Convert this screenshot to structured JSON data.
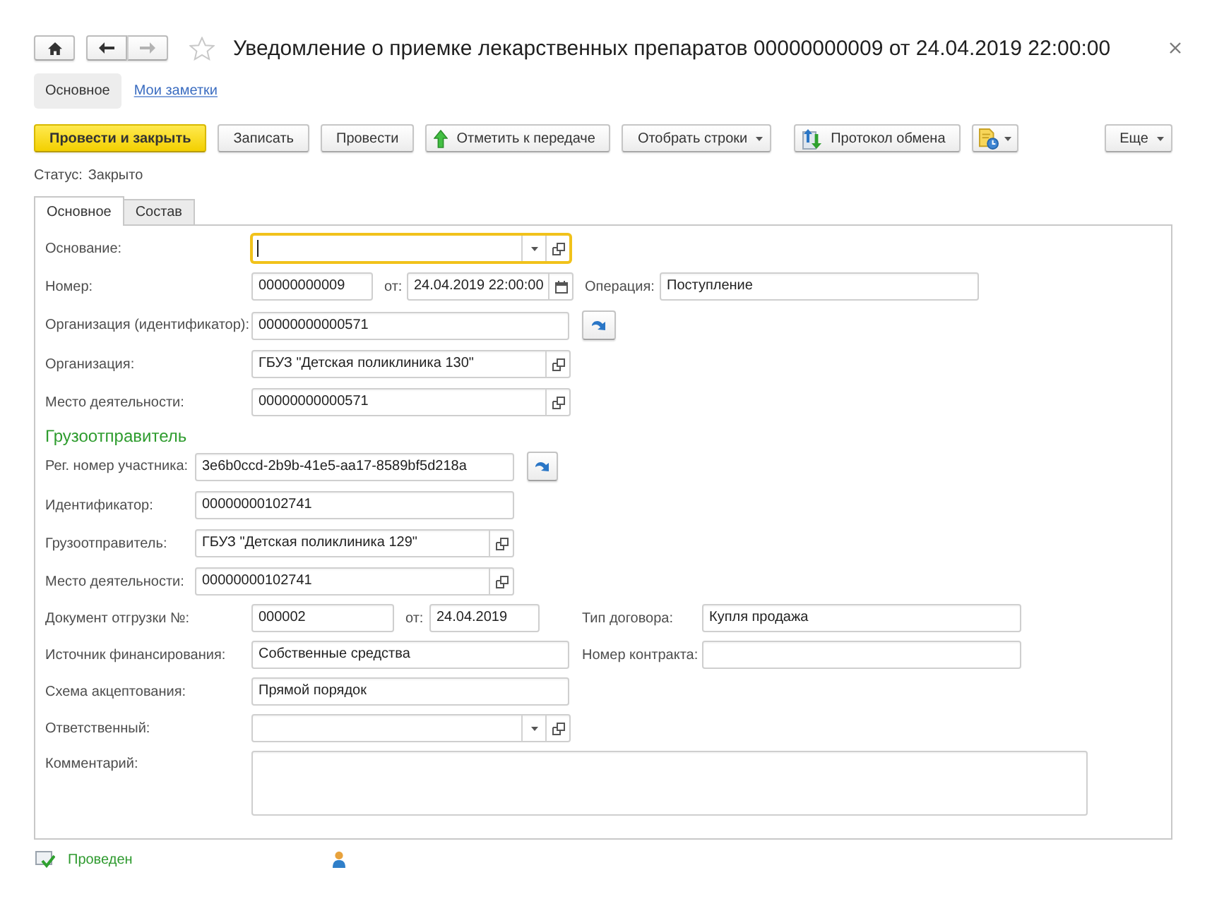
{
  "navigation": [
    {
      "kind": "home",
      "disabled": false
    },
    {
      "kind": "back",
      "disabled": false
    },
    {
      "kind": "forward",
      "disabled": true
    }
  ],
  "header": {
    "title": "Уведомление о приемке лекарственных препаратов 00000000009 от 24.04.2019 22:00:00",
    "starred": false
  },
  "sections": [
    {
      "label": "Основное",
      "selected": true
    },
    {
      "label": "Мои заметки",
      "selected": false
    }
  ],
  "toolbar": {
    "groups": [
      [
        {
          "label": "Провести и закрыть",
          "kind": "primary"
        },
        {
          "label": "Записать",
          "kind": "plain"
        },
        {
          "label": "Провести",
          "kind": "plain"
        },
        {
          "label": "Отметить к передаче",
          "kind": "icon"
        },
        {
          "label": "Отобрать строки",
          "kind": "menu"
        }
      ],
      [
        {
          "label": "Протокол обмена",
          "kind": "icon"
        },
        {
          "kind": "icon_menu"
        }
      ]
    ],
    "more": {
      "label": "Еще",
      "kind": "menu"
    }
  },
  "status": {
    "label": "Статус:",
    "value": "Закрыто"
  },
  "form_tabs": [
    {
      "label": "Основное",
      "selected": true
    },
    {
      "label": "Состав",
      "selected": false
    }
  ],
  "form": {
    "groups": [
      {
        "rows": [
          {
            "fields": [
              {
                "label": "Основание:",
                "kind": "select",
                "focused": true
              }
            ]
          },
          {
            "fields": [
              {
                "label": "Номер:",
                "value": "00000000009",
                "kind": "text",
                "focused": false
              },
              {
                "label": "от:",
                "value": "24.04.2019 22:00:00",
                "kind": "datetime",
                "focused": false
              },
              {
                "label": "Операция:",
                "value": "Поступление",
                "kind": "text",
                "focused": false
              }
            ]
          },
          {
            "fields": [
              {
                "label": "Организация (идентификатор):",
                "value": "00000000000571",
                "kind": "text",
                "focused": false
              }
            ],
            "jump_button": true
          },
          {
            "fields": [
              {
                "label": "Организация:",
                "value": "ГБУЗ \"Детская поликлиника 130\"",
                "kind": "ref",
                "focused": false
              }
            ]
          },
          {
            "fields": [
              {
                "label": "Место деятельности:",
                "value": "00000000000571",
                "kind": "ref",
                "focused": false
              }
            ]
          }
        ]
      },
      {
        "heading": "Грузоотправитель",
        "rows": [
          {
            "fields": [
              {
                "label": "Рег. номер участника:",
                "value": "3e6b0ccd-2b9b-41e5-aa17-8589bf5d218a",
                "kind": "text",
                "focused": false
              }
            ],
            "jump_button": true
          },
          {
            "fields": [
              {
                "label": "Идентификатор:",
                "value": "00000000102741",
                "kind": "text",
                "focused": false
              }
            ]
          },
          {
            "fields": [
              {
                "label": "Грузоотправитель:",
                "value": "ГБУЗ \"Детская поликлиника 129\"",
                "kind": "ref",
                "focused": false
              }
            ]
          },
          {
            "fields": [
              {
                "label": "Место деятельности:",
                "value": "00000000102741",
                "kind": "ref",
                "focused": false
              }
            ]
          }
        ]
      },
      {
        "rows": [
          {
            "fields": [
              {
                "label": "Документ отгрузки №:",
                "value": "000002",
                "kind": "text",
                "focused": false
              },
              {
                "label": "от:",
                "value": "24.04.2019",
                "kind": "date",
                "focused": false
              },
              {
                "label": "Тип договора:",
                "value": "Купля продажа",
                "kind": "text",
                "focused": false
              }
            ]
          },
          {
            "fields": [
              {
                "label": "Источник финансирования:",
                "value": "Собственные средства",
                "kind": "text",
                "focused": false
              },
              {
                "label": "Номер контракта:",
                "kind": "text",
                "focused": false
              }
            ]
          },
          {
            "fields": [
              {
                "label": "Схема акцептования:",
                "value": "Прямой порядок",
                "kind": "text",
                "focused": false
              }
            ]
          },
          {
            "fields": [
              {
                "label": "Ответственный:",
                "kind": "select",
                "focused": false
              }
            ]
          },
          {
            "fields": [
              {
                "label": "Комментарий:",
                "kind": "memo",
                "focused": false
              }
            ]
          }
        ]
      }
    ]
  },
  "status_bar": {
    "text": "Проведен"
  }
}
